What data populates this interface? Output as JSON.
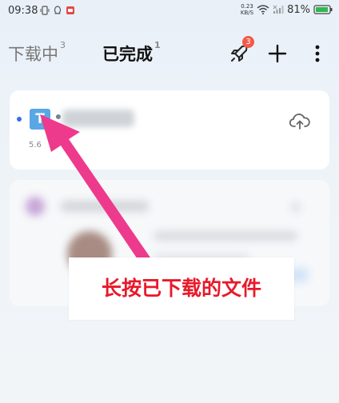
{
  "status_bar": {
    "time": "09:38",
    "net_speed_value": "0.23",
    "net_speed_unit": "KB/S",
    "battery": "81%"
  },
  "header": {
    "tabs": [
      {
        "label": "下载中",
        "count": "3"
      },
      {
        "label": "已完成",
        "count": "1"
      }
    ],
    "badge_count": "3"
  },
  "file_card": {
    "icon_letter": "T",
    "meta_prefix": "5.6"
  },
  "annotation": {
    "text": "长按已下载的文件",
    "color": "#e8192a",
    "arrow_color": "#ee3a8c"
  }
}
